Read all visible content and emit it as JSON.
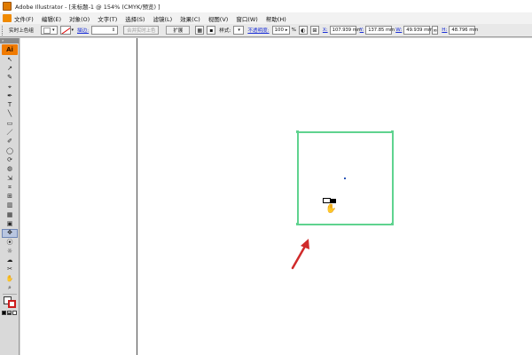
{
  "window": {
    "title": "Adobe Illustrator - [未标题-1 @ 154% (CMYK/预览) ]"
  },
  "menubar": {
    "items": [
      "文件(F)",
      "编辑(E)",
      "对象(O)",
      "文字(T)",
      "选择(S)",
      "滤镜(L)",
      "效果(C)",
      "视图(V)",
      "窗口(W)",
      "帮助(H)"
    ]
  },
  "control_bar": {
    "group_label": "实时上色组",
    "stroke_label": "描边:",
    "merge_button": "合并实时上色",
    "expand_button": "扩展",
    "style_label": "样式:",
    "opacity_label": "不透明度:",
    "opacity_value": "100",
    "opacity_unit": "%",
    "x_label": "X:",
    "x_value": "107.939 mm",
    "y_label": "Y:",
    "y_value": "137.85 mm",
    "w_label": "W:",
    "w_value": "49.939 mm",
    "h_label": "H:",
    "h_value": "48.796 mm"
  },
  "tools": {
    "logo": "Ai",
    "glyphs": [
      "↖",
      "↗",
      "✎",
      "⌖",
      "✒",
      "T",
      "╲",
      "▭",
      "／",
      "✐",
      "◯",
      "⟳",
      "◍",
      "⇲",
      "⌗",
      "⊞",
      "▥",
      "▦",
      "▣",
      "✥",
      "⦿",
      "☼",
      "☁",
      "✂",
      "✋",
      "⌕"
    ],
    "selected_index": 19
  },
  "colors": {
    "selection": "#5fd38f",
    "arrow": "#d02a2a",
    "logo": "#f07a00"
  }
}
